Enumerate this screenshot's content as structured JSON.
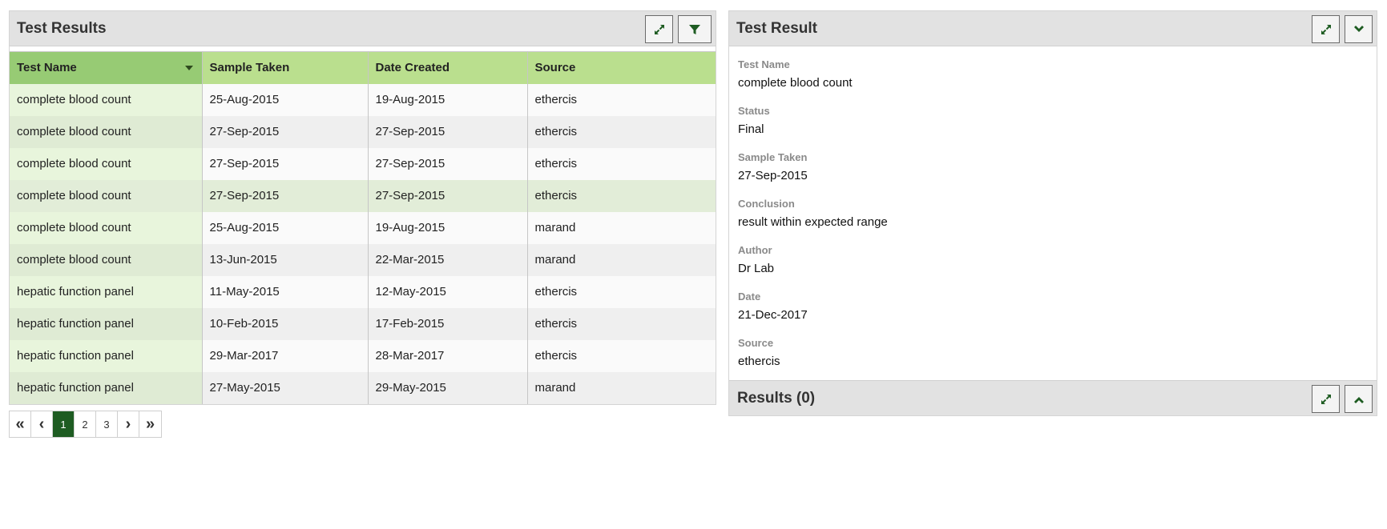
{
  "left_panel": {
    "title": "Test Results",
    "buttons": {
      "expand_icon": "expand-arrows-icon",
      "filter_icon": "filter-funnel-icon"
    },
    "table": {
      "columns": [
        "Test Name",
        "Sample Taken",
        "Date Created",
        "Source"
      ],
      "sorted_column": "Test Name",
      "rows": [
        [
          "complete blood count",
          "25-Aug-2015",
          "19-Aug-2015",
          "ethercis"
        ],
        [
          "complete blood count",
          "27-Sep-2015",
          "27-Sep-2015",
          "ethercis"
        ],
        [
          "complete blood count",
          "27-Sep-2015",
          "27-Sep-2015",
          "ethercis"
        ],
        [
          "complete blood count",
          "27-Sep-2015",
          "27-Sep-2015",
          "ethercis"
        ],
        [
          "complete blood count",
          "25-Aug-2015",
          "19-Aug-2015",
          "marand"
        ],
        [
          "complete blood count",
          "13-Jun-2015",
          "22-Mar-2015",
          "marand"
        ],
        [
          "hepatic function panel",
          "11-May-2015",
          "12-May-2015",
          "ethercis"
        ],
        [
          "hepatic function panel",
          "10-Feb-2015",
          "17-Feb-2015",
          "ethercis"
        ],
        [
          "hepatic function panel",
          "29-Mar-2017",
          "28-Mar-2017",
          "ethercis"
        ],
        [
          "hepatic function panel",
          "27-May-2015",
          "29-May-2015",
          "marand"
        ]
      ],
      "selected_row": 4
    },
    "pager": {
      "first": "«",
      "prev": "‹",
      "pages": [
        "1",
        "2",
        "3"
      ],
      "active_page": "1",
      "next": "›",
      "last": "»"
    }
  },
  "right_panel": {
    "title": "Test Result",
    "fields": {
      "test_name": {
        "label": "Test Name",
        "value": "complete blood count"
      },
      "status": {
        "label": "Status",
        "value": "Final"
      },
      "sample_taken": {
        "label": "Sample Taken",
        "value": "27-Sep-2015"
      },
      "conclusion": {
        "label": "Conclusion",
        "value": "result within expected range"
      },
      "author": {
        "label": "Author",
        "value": "Dr Lab"
      },
      "date": {
        "label": "Date",
        "value": "21-Dec-2017"
      },
      "source": {
        "label": "Source",
        "value": "ethercis"
      }
    },
    "results": {
      "title": "Results (0)"
    },
    "buttons": {
      "expand_icon": "expand-arrows-icon",
      "collapse_icon": "chevron-down-icon",
      "results_toggle_icon": "chevron-up-icon"
    }
  },
  "colors": {
    "header_green": "#badf8e",
    "sorted_header_green": "#97cb74",
    "icon_green": "#1e5c22",
    "active_page_bg": "#1e5c22"
  }
}
